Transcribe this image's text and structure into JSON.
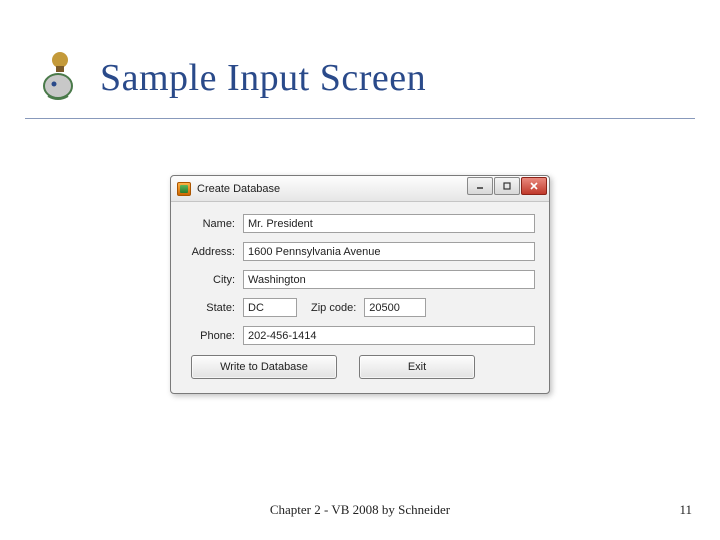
{
  "slide": {
    "title": "Sample Input Screen",
    "footer": "Chapter 2 - VB 2008 by Schneider",
    "page_number": "11"
  },
  "window": {
    "title": "Create Database",
    "fields": {
      "name_label": "Name:",
      "name_value": "Mr. President",
      "address_label": "Address:",
      "address_value": "1600 Pennsylvania Avenue",
      "city_label": "City:",
      "city_value": "Washington",
      "state_label": "State:",
      "state_value": "DC",
      "zip_label": "Zip code:",
      "zip_value": "20500",
      "phone_label": "Phone:",
      "phone_value": "202-456-1414"
    },
    "buttons": {
      "write": "Write to Database",
      "exit": "Exit"
    }
  }
}
